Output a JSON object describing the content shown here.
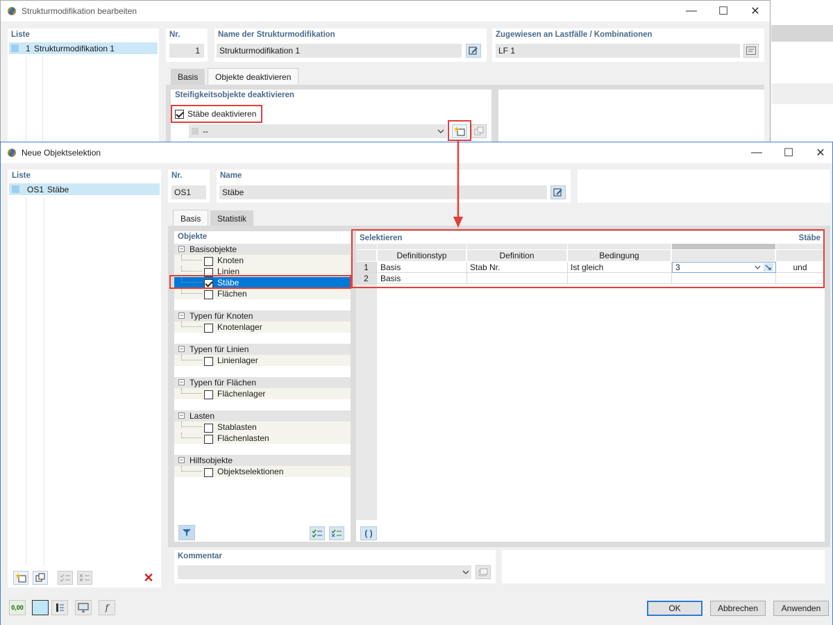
{
  "bg_window": {
    "title": "Strukturmodifikation bearbeiten",
    "liste_label": "Liste",
    "list_items": [
      {
        "nr": "1",
        "name": "Strukturmodifikation 1"
      }
    ],
    "nr_label": "Nr.",
    "nr_value": "1",
    "name_label": "Name der Strukturmodifikation",
    "name_value": "Strukturmodifikation 1",
    "assigned_label": "Zugewiesen an Lastfälle / Kombinationen",
    "assigned_value": "LF 1",
    "tabs": [
      "Basis",
      "Objekte deaktivieren"
    ],
    "section_label": "Steifigkeitsobjekte deaktivieren",
    "checkbox_label": "Stäbe deaktivieren",
    "checkbox_checked": true,
    "dropdown_value": "--"
  },
  "fg_window": {
    "title": "Neue Objektselektion",
    "liste_label": "Liste",
    "list_items": [
      {
        "nr": "OS1",
        "name": "Stäbe"
      }
    ],
    "nr_label": "Nr.",
    "nr_value": "OS1",
    "name_label": "Name",
    "name_value": "Stäbe",
    "tabs": [
      "Basis",
      "Statistik"
    ],
    "objects_label": "Objekte",
    "tree": [
      {
        "group": "Basisobjekte",
        "items": [
          {
            "label": "Knoten",
            "checked": false
          },
          {
            "label": "Linien",
            "checked": false
          },
          {
            "label": "Stäbe",
            "checked": true,
            "selected": true
          },
          {
            "label": "Flächen",
            "checked": false
          }
        ]
      },
      {
        "group": "Typen für Knoten",
        "items": [
          {
            "label": "Knotenlager",
            "checked": false
          }
        ]
      },
      {
        "group": "Typen für Linien",
        "items": [
          {
            "label": "Linienlager",
            "checked": false
          }
        ]
      },
      {
        "group": "Typen für Flächen",
        "items": [
          {
            "label": "Flächenlager",
            "checked": false
          }
        ]
      },
      {
        "group": "Lasten",
        "items": [
          {
            "label": "Stablasten",
            "checked": false
          },
          {
            "label": "Flächenlasten",
            "checked": false
          }
        ]
      },
      {
        "group": "Hilfsobjekte",
        "items": [
          {
            "label": "Objektselektionen",
            "checked": false
          }
        ]
      }
    ],
    "select_label": "Selektieren",
    "select_target": "Stäbe",
    "grid_headers": [
      "Definitionstyp",
      "Definition",
      "Bedingung"
    ],
    "grid_rows": [
      {
        "n": "1",
        "deftype": "Basis",
        "def": "Stab Nr.",
        "cond": "Ist gleich",
        "value": "3",
        "logic": "und"
      },
      {
        "n": "2",
        "deftype": "Basis",
        "def": "",
        "cond": "",
        "value": "",
        "logic": ""
      }
    ],
    "paren_label": "( )",
    "kommentar_label": "Kommentar",
    "kommentar_value": "",
    "buttons": {
      "ok": "OK",
      "cancel": "Abbrechen",
      "apply": "Anwenden"
    },
    "bottom_value": "0,00"
  },
  "colors": {
    "highlight": "#e0403a",
    "selection": "#0078d7",
    "accent_label": "#4a6a8c"
  }
}
